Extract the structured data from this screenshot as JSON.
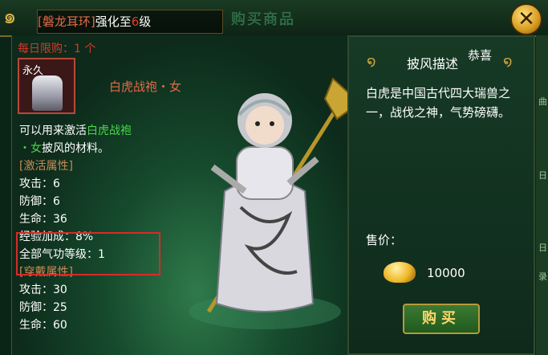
{
  "header": {
    "strip_bracket_open": "[",
    "strip_item": "磐龙耳环",
    "strip_bracket_close": "]",
    "strip_text_a": "强化至",
    "strip_level": "6",
    "strip_text_b": "级",
    "title": "购买商品",
    "close_label": "✕"
  },
  "item": {
    "daily_limit": "每日限购：1 个",
    "box_label": "永久",
    "name": "白虎战袍・女",
    "desc_a": "可以用来激活",
    "desc_link_1": "白虎战袍",
    "desc_link_2": "・女",
    "desc_b": "披风的材料。",
    "activate_header": "[激活属性]",
    "activate_stats": [
      "攻击：6",
      "防御：6",
      "生命：36"
    ],
    "bonus_stats": [
      "经验加成：8%",
      "全部气功等级：1"
    ],
    "wear_header": "[穿戴属性]",
    "wear_stats": [
      "攻击：30",
      "防御：25",
      "生命：60"
    ]
  },
  "panel": {
    "heading": "披风描述",
    "congrats": "恭喜",
    "description": "白虎是中国古代四大瑞兽之一，战伐之神，气势磅礴。",
    "price_label": "售价：",
    "price_value": "10000",
    "buy_label": "购买"
  },
  "edge_labels": [
    "曲",
    "日",
    "日",
    "录"
  ],
  "colors": {
    "accent_gold": "#d8b34a",
    "red_text": "#d33a2a",
    "green_link": "#48d84a",
    "section": "#c98a55"
  }
}
